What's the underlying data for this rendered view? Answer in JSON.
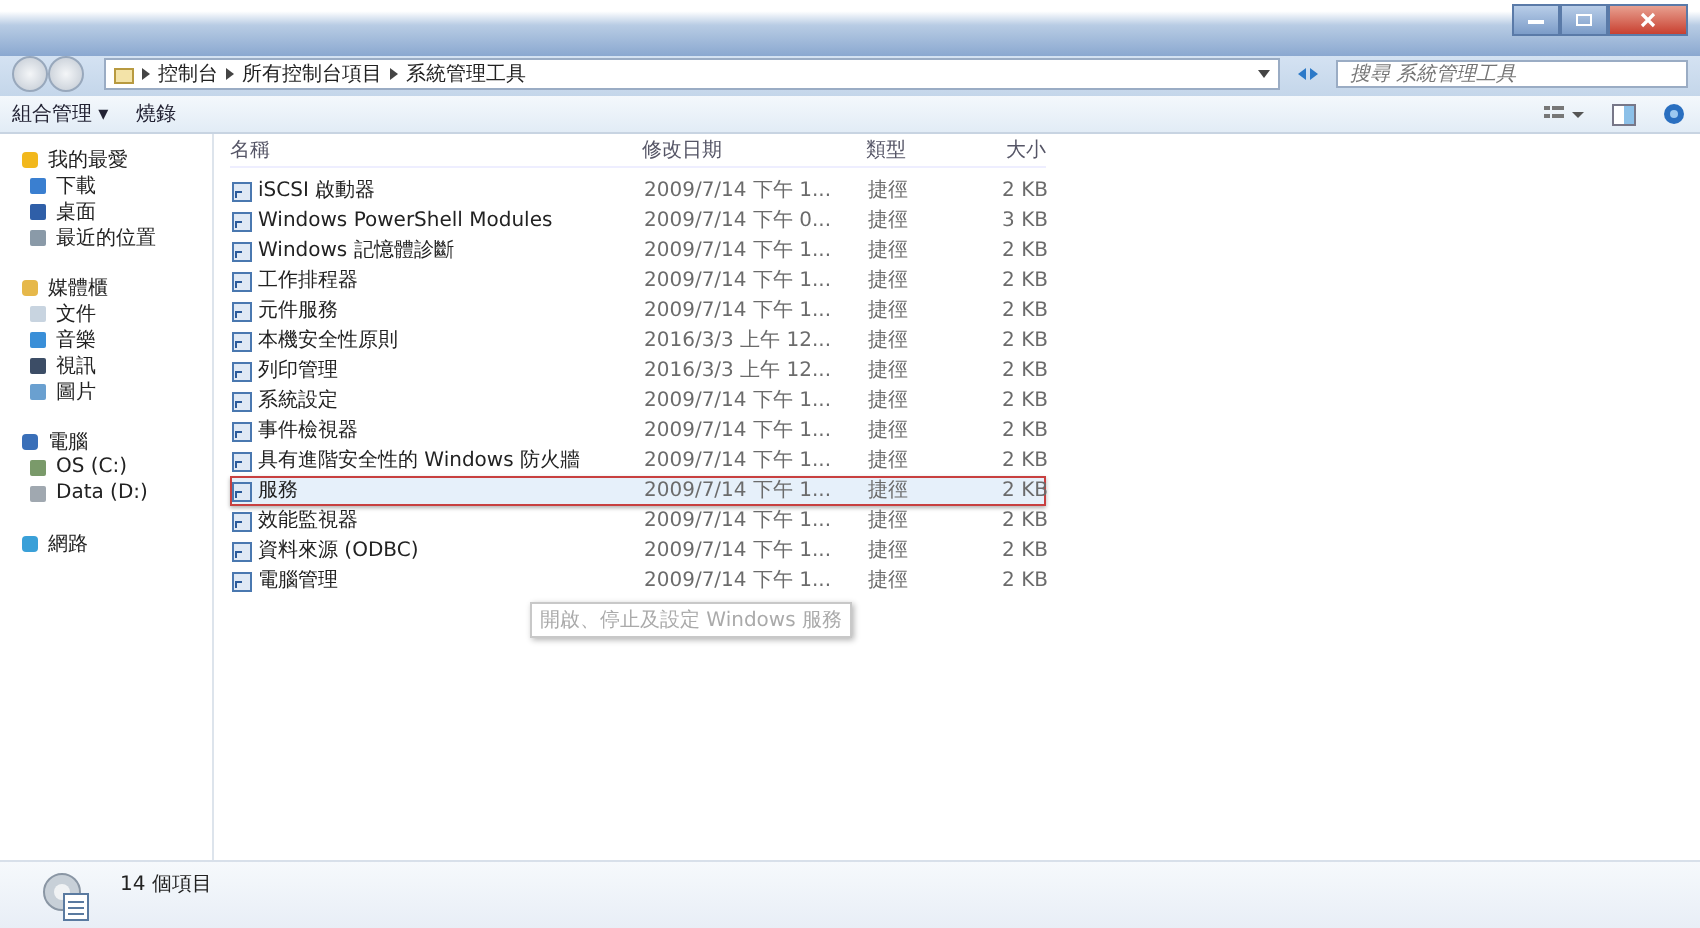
{
  "breadcrumb": [
    "控制台",
    "所有控制台項目",
    "系統管理工具"
  ],
  "search": {
    "placeholder": "搜尋 系統管理工具"
  },
  "toolbar": {
    "organize": "組合管理 ▾",
    "burn": "燒錄"
  },
  "sidebar": [
    {
      "label": "我的最愛",
      "children": [
        {
          "label": "下載"
        },
        {
          "label": "桌面"
        },
        {
          "label": "最近的位置"
        }
      ]
    },
    {
      "label": "媒體櫃",
      "children": [
        {
          "label": "文件"
        },
        {
          "label": "音樂"
        },
        {
          "label": "視訊"
        },
        {
          "label": "圖片"
        }
      ]
    },
    {
      "label": "電腦",
      "children": [
        {
          "label": "OS (C:)"
        },
        {
          "label": "Data (D:)"
        }
      ]
    },
    {
      "label": "網路"
    }
  ],
  "columns": [
    "名稱",
    "修改日期",
    "類型",
    "大小"
  ],
  "rows": [
    {
      "name": "iSCSI 啟動器",
      "date": "2009/7/14 下午 1...",
      "type": "捷徑",
      "size": "2 KB",
      "selected": false
    },
    {
      "name": "Windows PowerShell Modules",
      "date": "2009/7/14 下午 0...",
      "type": "捷徑",
      "size": "3 KB",
      "selected": false
    },
    {
      "name": "Windows 記憶體診斷",
      "date": "2009/7/14 下午 1...",
      "type": "捷徑",
      "size": "2 KB",
      "selected": false
    },
    {
      "name": "工作排程器",
      "date": "2009/7/14 下午 1...",
      "type": "捷徑",
      "size": "2 KB",
      "selected": false
    },
    {
      "name": "元件服務",
      "date": "2009/7/14 下午 1...",
      "type": "捷徑",
      "size": "2 KB",
      "selected": false
    },
    {
      "name": "本機安全性原則",
      "date": "2016/3/3 上午 12...",
      "type": "捷徑",
      "size": "2 KB",
      "selected": false
    },
    {
      "name": "列印管理",
      "date": "2016/3/3 上午 12...",
      "type": "捷徑",
      "size": "2 KB",
      "selected": false
    },
    {
      "name": "系統設定",
      "date": "2009/7/14 下午 1...",
      "type": "捷徑",
      "size": "2 KB",
      "selected": false
    },
    {
      "name": "事件檢視器",
      "date": "2009/7/14 下午 1...",
      "type": "捷徑",
      "size": "2 KB",
      "selected": false
    },
    {
      "name": "具有進階安全性的 Windows 防火牆",
      "date": "2009/7/14 下午 1...",
      "type": "捷徑",
      "size": "2 KB",
      "selected": false
    },
    {
      "name": "服務",
      "date": "2009/7/14 下午 1...",
      "type": "捷徑",
      "size": "2 KB",
      "selected": true
    },
    {
      "name": "效能監視器",
      "date": "2009/7/14 下午 1...",
      "type": "捷徑",
      "size": "2 KB",
      "selected": false
    },
    {
      "name": "資料來源 (ODBC)",
      "date": "2009/7/14 下午 1...",
      "type": "捷徑",
      "size": "2 KB",
      "selected": false
    },
    {
      "name": "電腦管理",
      "date": "2009/7/14 下午 1...",
      "type": "捷徑",
      "size": "2 KB",
      "selected": false
    }
  ],
  "tooltip": "開啟、停止及設定 Windows 服務",
  "status_bar": {
    "count": "14 個項目"
  }
}
